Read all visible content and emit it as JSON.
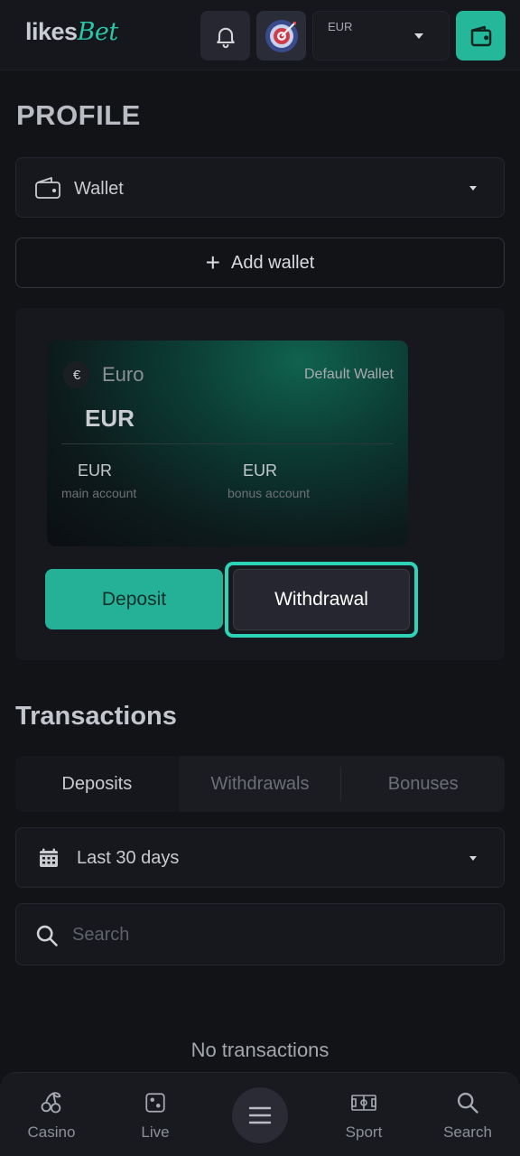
{
  "header": {
    "logo_part1": "likes",
    "logo_part2": "Bet",
    "currency_label": "EUR"
  },
  "page": {
    "title": "PROFILE"
  },
  "wallet_select": {
    "label": "Wallet"
  },
  "add_wallet": {
    "label": "Add wallet"
  },
  "wallet_card": {
    "currency_symbol": "€",
    "currency_name": "Euro",
    "default_label": "Default Wallet",
    "currency_code": "EUR",
    "main_account": {
      "value": "EUR",
      "label": "main account"
    },
    "bonus_account": {
      "value": "EUR",
      "label": "bonus account"
    }
  },
  "actions": {
    "deposit": "Deposit",
    "withdrawal": "Withdrawal"
  },
  "transactions": {
    "title": "Transactions",
    "tabs": [
      "Deposits",
      "Withdrawals",
      "Bonuses"
    ],
    "active_tab": "Deposits",
    "period": "Last 30 days",
    "search_placeholder": "Search",
    "empty_text": "No transactions"
  },
  "bottom_nav": {
    "items": [
      {
        "label": "Casino",
        "icon": "cherries-icon"
      },
      {
        "label": "Live",
        "icon": "dice-icon"
      },
      {
        "label": "Sport",
        "icon": "field-icon"
      },
      {
        "label": "Search",
        "icon": "search-icon"
      }
    ],
    "menu_icon": "hamburger-menu-icon"
  },
  "colors": {
    "accent": "#25b197",
    "highlight_border": "#2ed3b7",
    "background": "#121317"
  }
}
